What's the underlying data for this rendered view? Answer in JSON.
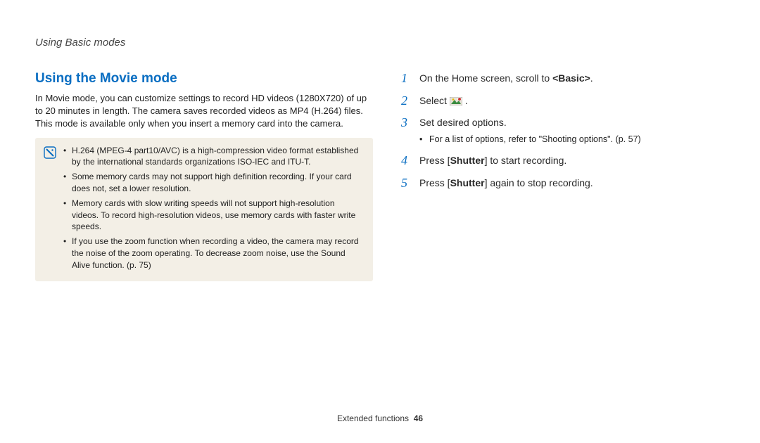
{
  "breadcrumb": "Using Basic modes",
  "section_title": "Using the Movie mode",
  "intro": "In Movie mode, you can customize settings to record HD videos (1280X720) of up to 20 minutes in length. The camera saves recorded videos as MP4 (H.264) files. This mode is available only when you insert a memory card into the camera.",
  "notes": [
    "H.264 (MPEG-4 part10/AVC) is a high-compression video format established by the international standards organizations ISO-IEC and ITU-T.",
    "Some memory cards may not support high definition recording. If your card does not, set a lower resolution.",
    "Memory cards with slow writing speeds will not support high-resolution videos. To record high-resolution videos, use memory cards with faster write speeds.",
    "If you use the zoom function when recording a video, the camera may record the noise of the zoom operating. To decrease zoom noise, use the Sound Alive function. (p. 75)"
  ],
  "steps": [
    {
      "num": "1",
      "pre": "On the Home screen, scroll to ",
      "bold": "<Basic>",
      "post": "."
    },
    {
      "num": "2",
      "pre": "Select ",
      "icon": true,
      "post": " ."
    },
    {
      "num": "3",
      "pre": "Set desired options.",
      "sub": "For a list of options, refer to \"Shooting options\". (p. 57)"
    },
    {
      "num": "4",
      "pre": "Press [",
      "bold": "Shutter",
      "post": "] to start recording."
    },
    {
      "num": "5",
      "pre": "Press [",
      "bold": "Shutter",
      "post": "] again to stop recording."
    }
  ],
  "footer_label": "Extended functions",
  "footer_page": "46"
}
